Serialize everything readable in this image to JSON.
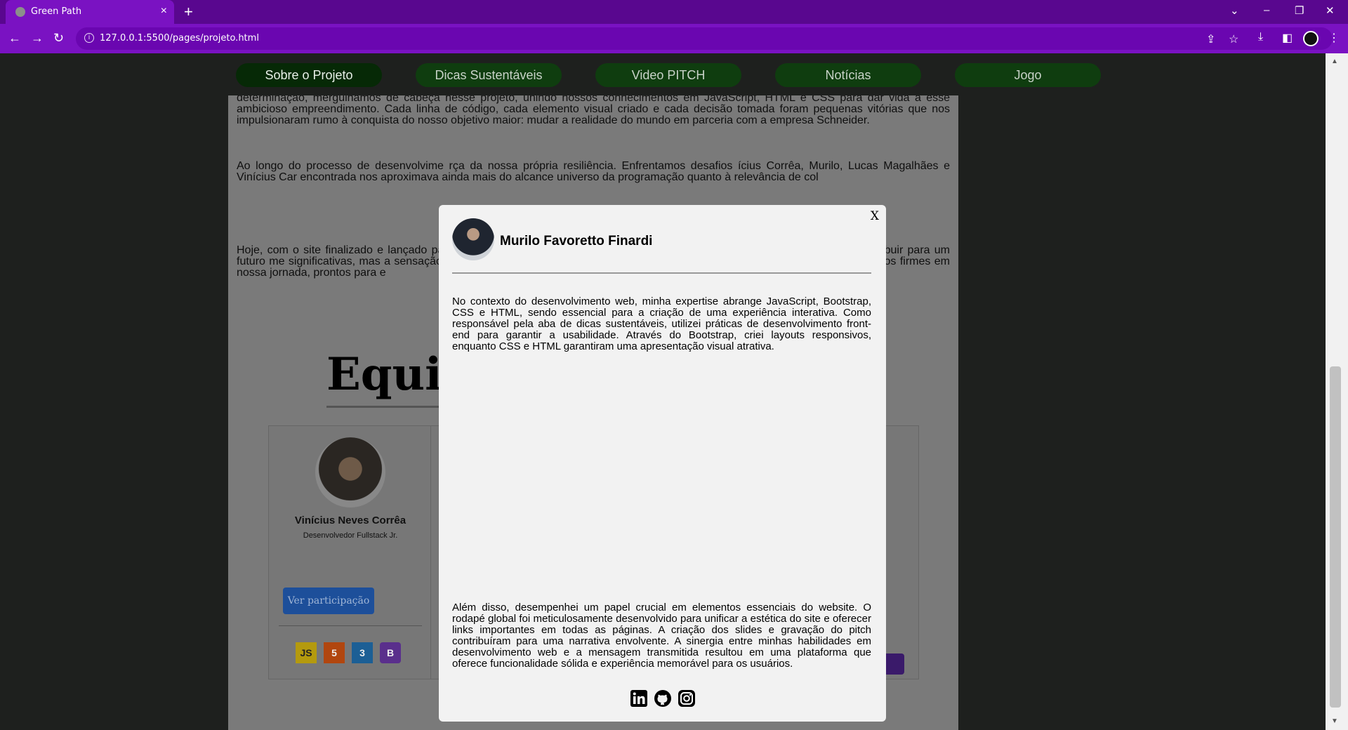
{
  "browser": {
    "tab_title": "Green Path",
    "tab_close": "×",
    "new_tab": "+",
    "url": "127.0.0.1:5500/pages/projeto.html",
    "info": "i"
  },
  "nav": {
    "items": [
      "Sobre o Projeto",
      "Dicas Sustentáveis",
      "Video PITCH",
      "Notícias",
      "Jogo"
    ]
  },
  "page": {
    "para1": "determinação, mergulhamos de cabeça nesse projeto, unindo nossos conhecimentos em JavaScript, HTML e CSS para dar vida a esse ambicioso empreendimento. Cada linha de código, cada elemento visual criado e cada decisão tomada foram pequenas vitórias que nos impulsionaram rumo à conquista do nosso objetivo maior: mudar a realidade do mundo em parceria com a empresa Schneider.",
    "para2": "   Ao longo do processo de desenvolvime                                                                                 rça da nossa própria resiliência. Enfrentamos desafios                                                                               ícius Corrêa, Murilo, Lucas Magalhães e Vinícius Car                                                                              encontrada nos aproximava ainda mais do alcance                                                                              universo da programação quanto à relevância de col",
    "para3": "   Hoje, com o site finalizado e lançado pa                                                                                stante. Cada linhade código e cada detalhe visual ref                                                                             ém o desejo genuíno de contribuir para um futuro me                                                                            significativas, mas a sensação de conquista e aprend                                                                            rceria com a Schneider nos impulsiona a ir além, tor                                                                            m, seguimos firmes em nossa jornada, prontos para e",
    "team_heading": "Equip"
  },
  "card": {
    "name": "Vinícius Neves Corrêa",
    "role": "Desenvolvedor Fullstack Jr.",
    "button": "Ver participação",
    "tech": [
      "JS",
      "5",
      "3",
      "B"
    ]
  },
  "modal": {
    "close": "X",
    "name": "Murilo Favoretto Finardi",
    "paragraph1": "   No contexto do desenvolvimento web, minha expertise abrange JavaScript, Bootstrap, CSS e HTML, sendo essencial para a criação de uma experiência interativa. Como responsável pela aba de dicas sustentáveis, utilizei práticas de desenvolvimento front-end para garantir a usabilidade. Através do Bootstrap, criei layouts responsivos, enquanto CSS e HTML garantiram uma apresentação visual atrativa.",
    "paragraph2": "   Além disso, desempenhei um papel crucial em elementos essenciais do website. O rodapé global foi meticulosamente desenvolvido para unificar a estética do site e oferecer links importantes em todas as páginas. A criação dos slides e gravação do pitch contribuíram para uma narrativa envolvente. A sinergia entre minhas habilidades em desenvolvimento web e a mensagem transmitida resultou em uma plataforma que oferece funcionalidade sólida e experiência memorável para os usuários.",
    "social_icons": [
      "linkedin-icon",
      "github-icon",
      "instagram-icon"
    ]
  }
}
